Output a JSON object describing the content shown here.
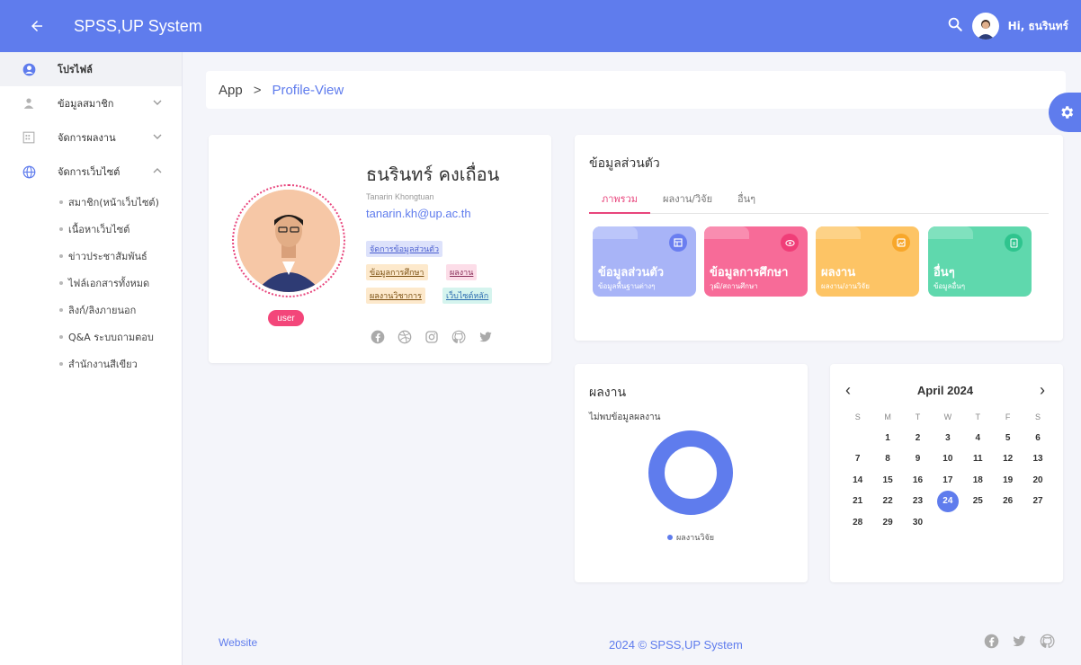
{
  "colors": {
    "primary": "#5f7ced",
    "pink": "#f3467a",
    "tile_blue": "#a8b4f7",
    "tile_pink": "#f76b98",
    "tile_orange": "#fdc465",
    "tile_green": "#5fd8ad"
  },
  "topbar": {
    "title": "SPSS,UP System",
    "greeting": "Hi, ธนรินทร์",
    "icons": [
      "arrow-left-icon",
      "search-icon",
      "avatar"
    ]
  },
  "sidebar": {
    "items": [
      {
        "label": "โปรไฟล์",
        "icon": "user-circle-icon",
        "active": true
      },
      {
        "label": "ข้อมูลสมาชิก",
        "icon": "person-icon",
        "chevron": "down"
      },
      {
        "label": "จัดการผลงาน",
        "icon": "building-icon",
        "chevron": "down"
      },
      {
        "label": "จัดการเว็บไซต์",
        "icon": "globe-icon",
        "chevron": "up"
      }
    ],
    "subitems": [
      "สมาชิก(หน้าเว็บไซต์)",
      "เนื้อหาเว็บไซต์",
      "ข่าวประชาสัมพันธ์",
      "ไฟล์เอกสารทั้งหมด",
      "ลิงก์/ลิงภายนอก",
      "Q&A ระบบถามตอบ",
      "สำนักงานสีเขียว"
    ]
  },
  "breadcrumb": {
    "root": "App",
    "separator": ">",
    "current": "Profile-View"
  },
  "profile": {
    "name_th": "ธนรินทร์ คงเถื่อน",
    "name_en": "Tanarin Khongtuan",
    "email": "tanarin.kh@up.ac.th",
    "role": "user",
    "tags": [
      "จัดการข้อมูลส่วนตัว",
      "ข้อมูลการศึกษา",
      "ผลงาน",
      "ผลงานวิชาการ",
      "เว็บไซต์หลัก"
    ],
    "socials": [
      "facebook-icon",
      "dribbble-icon",
      "instagram-icon",
      "github-icon",
      "twitter-icon"
    ]
  },
  "info": {
    "title": "ข้อมูลส่วนตัว",
    "tabs": [
      "ภาพรวม",
      "ผลงาน/วิจัย",
      "อื่นๆ"
    ],
    "tiles": [
      {
        "title": "ข้อมูลส่วนตัว",
        "sub": "ข้อมูลพื้นฐานต่างๆ",
        "icon": "layout-icon"
      },
      {
        "title": "ข้อมูลการศึกษา",
        "sub": "วุฒิ/สถานศึกษา",
        "icon": "eye-icon"
      },
      {
        "title": "ผลงาน",
        "sub": "ผลงาน/งานวิจัย",
        "icon": "image-icon"
      },
      {
        "title": "อื่นๆ",
        "sub": "ข้อมูลอื่นๆ",
        "icon": "file-icon"
      }
    ]
  },
  "works": {
    "title": "ผลงาน",
    "empty_text": "ไม่พบข้อมูลผลงาน",
    "legend": "ผลงานวิจัย"
  },
  "calendar": {
    "month": "April 2024",
    "prev": "‹",
    "next": "›",
    "weekdays": [
      "S",
      "M",
      "T",
      "W",
      "T",
      "F",
      "S"
    ],
    "start_offset": 1,
    "days": 30,
    "today": 24
  },
  "footer": {
    "link": "Website",
    "copyright": "2024 © SPSS,UP System",
    "icons": [
      "facebook-icon",
      "twitter-icon",
      "github-icon"
    ]
  }
}
